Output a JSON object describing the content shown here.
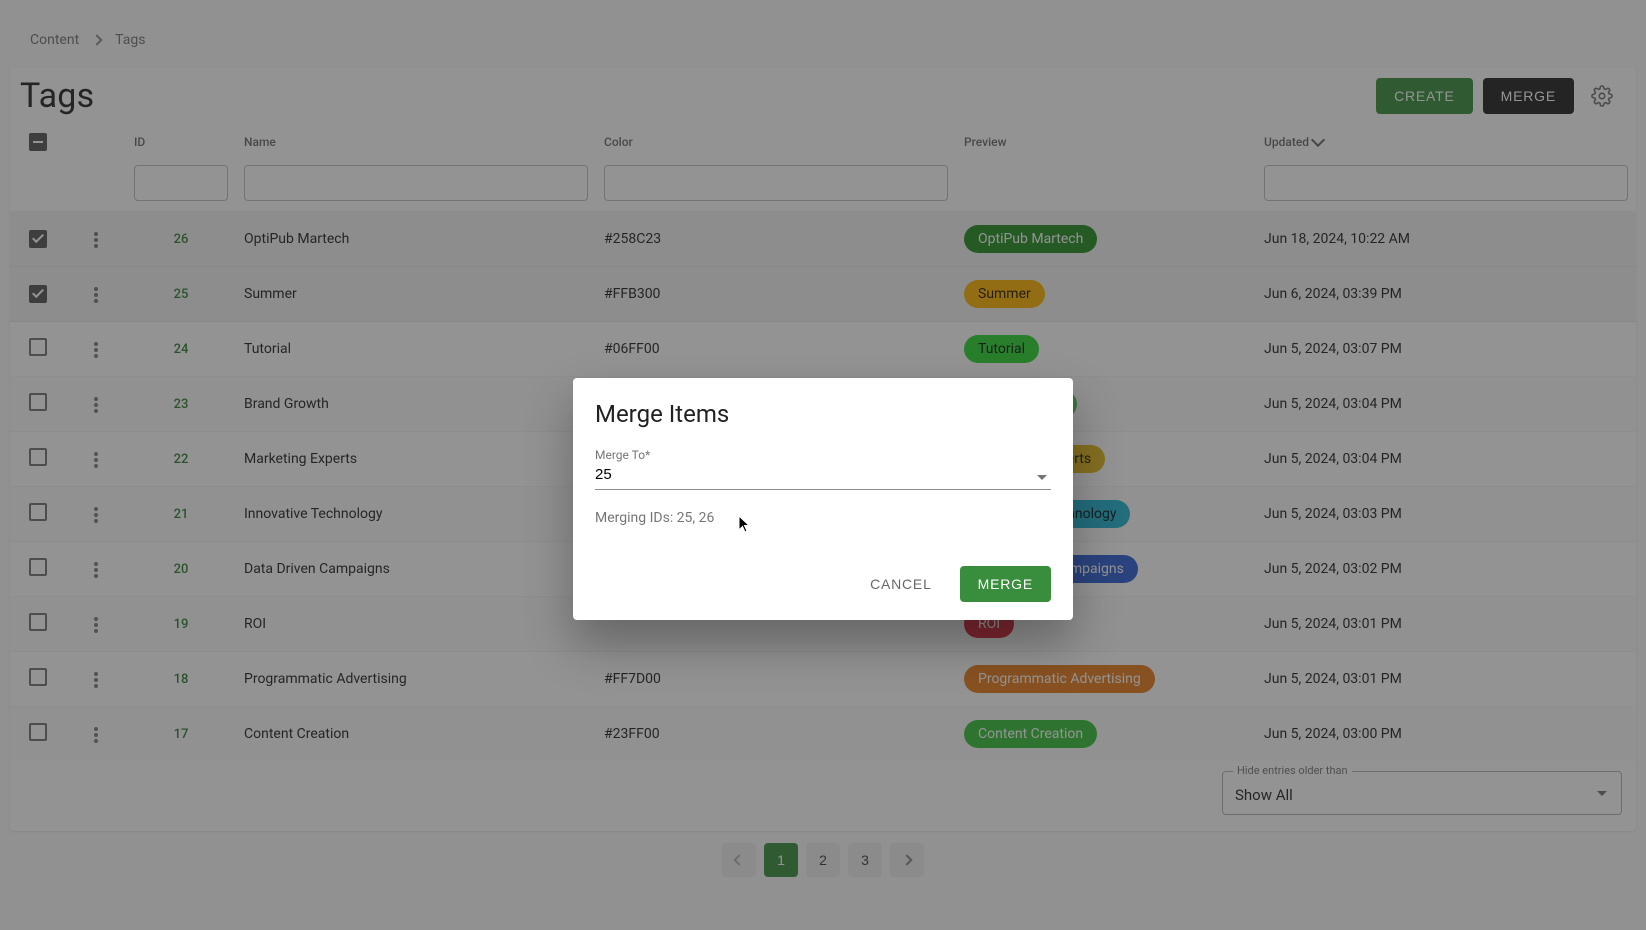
{
  "breadcrumbs": [
    "Content",
    "Tags"
  ],
  "pageTitle": "Tags",
  "actions": {
    "create": "CREATE",
    "merge": "MERGE"
  },
  "columns": {
    "id": "ID",
    "name": "Name",
    "color": "Color",
    "preview": "Preview",
    "updated": "Updated"
  },
  "rows": [
    {
      "checked": true,
      "id": "26",
      "name": "OptiPub Martech",
      "color": "#258C23",
      "chipColor": "#258C23",
      "chipDark": false,
      "updated": "Jun 18, 2024, 10:22 AM"
    },
    {
      "checked": true,
      "id": "25",
      "name": "Summer",
      "color": "#FFB300",
      "chipColor": "#FFB300",
      "chipDark": true,
      "updated": "Jun 6, 2024, 03:39 PM"
    },
    {
      "checked": false,
      "id": "24",
      "name": "Tutorial",
      "color": "#06FF00",
      "chipColor": "#2bd431",
      "chipDark": true,
      "updated": "Jun 5, 2024, 03:07 PM"
    },
    {
      "checked": false,
      "id": "23",
      "name": "Brand Growth",
      "color": "",
      "chipColor": "#47c44a",
      "chipDark": true,
      "updated": "Jun 5, 2024, 03:04 PM"
    },
    {
      "checked": false,
      "id": "22",
      "name": "Marketing Experts",
      "color": "",
      "chipColor": "#e1b71a",
      "chipDark": true,
      "updated": "Jun 5, 2024, 03:04 PM"
    },
    {
      "checked": false,
      "id": "21",
      "name": "Innovative Technology",
      "color": "",
      "chipColor": "#1fb3d1",
      "chipDark": true,
      "updated": "Jun 5, 2024, 03:03 PM"
    },
    {
      "checked": false,
      "id": "20",
      "name": "Data Driven Campaigns",
      "color": "",
      "chipColor": "#2d5fd4",
      "chipDark": false,
      "updated": "Jun 5, 2024, 03:02 PM"
    },
    {
      "checked": false,
      "id": "19",
      "name": "ROI",
      "color": "",
      "chipColor": "#d6263a",
      "chipDark": false,
      "updated": "Jun 5, 2024, 03:01 PM"
    },
    {
      "checked": false,
      "id": "18",
      "name": "Programmatic Advertising",
      "color": "#FF7D00",
      "chipColor": "#e87b1a",
      "chipDark": false,
      "updated": "Jun 5, 2024, 03:01 PM"
    },
    {
      "checked": false,
      "id": "17",
      "name": "Content Creation",
      "color": "#23FF00",
      "chipColor": "#35c139",
      "chipDark": false,
      "updated": "Jun 5, 2024, 03:00 PM"
    }
  ],
  "hideEntries": {
    "legend": "Hide entries older than",
    "value": "Show All"
  },
  "pagination": {
    "current": 1,
    "pages": [
      "1",
      "2",
      "3"
    ]
  },
  "dialog": {
    "title": "Merge Items",
    "fieldLabel": "Merge To*",
    "fieldValue": "25",
    "mergingText": "Merging IDs: 25, 26",
    "cancel": "CANCEL",
    "merge": "MERGE"
  }
}
